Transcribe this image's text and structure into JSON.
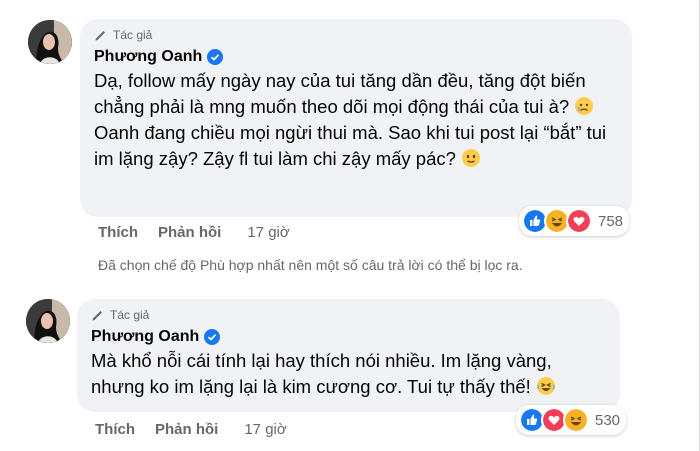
{
  "comments": [
    {
      "author_tag": "Tác giả",
      "author_name": "Phương Oanh",
      "text_before_emoji1": "Dạ, follow mấy ngày nay của tui tăng dần đều, tăng đột biến chẳng phải là mng muốn theo dõi mọi động thái của tui à?",
      "text_after_emoji1": " Oanh đang chiều mọi ngừi thui mà. Sao khi tui post lại “bắt” tui im lặng zậy? Zậy fl tui làm chi zậy mấy pác?",
      "emoji1": "sad-face-emoji",
      "emoji2": "smile-face-emoji",
      "reactions": [
        "like",
        "haha",
        "love"
      ],
      "reaction_count": "758",
      "actions": {
        "like": "Thích",
        "reply": "Phản hồi",
        "time": "17 giờ"
      }
    },
    {
      "author_tag": "Tác giả",
      "author_name": "Phương Oanh",
      "text": "Mà khổ nỗi cái tính lại hay thích nói nhiều. Im lặng vàng, nhưng ko im lặng lại là kim cương cơ. Tui tự thấy thế!",
      "emoji": "laughing-emoji",
      "reactions": [
        "like",
        "love",
        "haha"
      ],
      "reaction_count": "530",
      "actions": {
        "like": "Thích",
        "reply": "Phản hồi",
        "time": "17 giờ"
      }
    }
  ],
  "filter_note": "Đã chọn chế độ Phù hợp nhất nên một số câu trả lời có thể bị lọc ra.",
  "colors": {
    "bubble": "#f0f2f5",
    "verified": "#1877f2",
    "meta": "#65676b"
  }
}
